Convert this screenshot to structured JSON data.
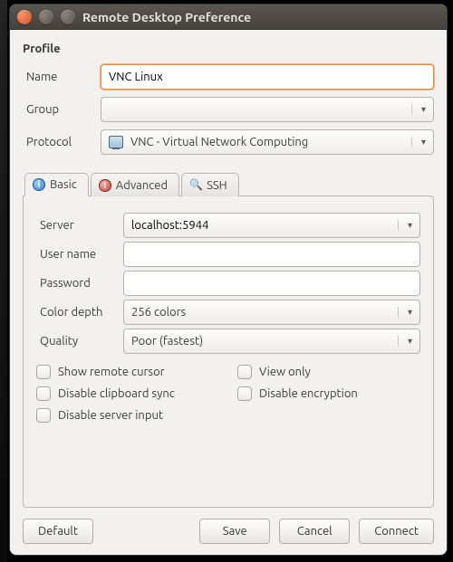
{
  "window": {
    "title": "Remote Desktop Preference"
  },
  "profile": {
    "heading": "Profile",
    "name_label": "Name",
    "name_value": "VNC Linux",
    "group_label": "Group",
    "group_value": "",
    "protocol_label": "Protocol",
    "protocol_value": "VNC - Virtual Network Computing"
  },
  "tabs": {
    "basic": "Basic",
    "advanced": "Advanced",
    "ssh": "SSH"
  },
  "basic": {
    "server_label": "Server",
    "server_value": "localhost:5944",
    "user_label": "User name",
    "user_value": "",
    "password_label": "Password",
    "password_value": "",
    "colordepth_label": "Color depth",
    "colordepth_value": "256 colors",
    "quality_label": "Quality",
    "quality_value": "Poor (fastest)",
    "checks": {
      "show_remote_cursor": "Show remote cursor",
      "view_only": "View only",
      "disable_clipboard_sync": "Disable clipboard sync",
      "disable_encryption": "Disable encryption",
      "disable_server_input": "Disable server input"
    }
  },
  "buttons": {
    "default": "Default",
    "save": "Save",
    "cancel": "Cancel",
    "connect": "Connect"
  }
}
